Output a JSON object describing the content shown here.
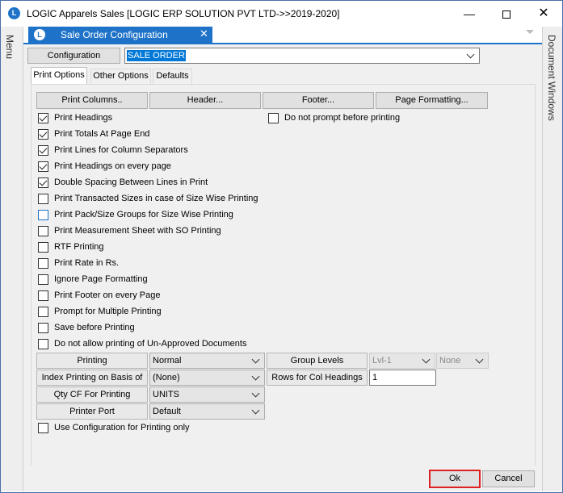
{
  "window": {
    "title": "LOGIC Apparels Sales  [LOGIC ERP SOLUTION PVT LTD->>2019-2020]",
    "app_icon_glyph": "L"
  },
  "side_panels": {
    "left": "Menu",
    "right": "Document Windows"
  },
  "doc_tab": {
    "label": "Sale Order Configuration",
    "close": "✕"
  },
  "configuration": {
    "button_label": "Configuration",
    "selected_value": "SALE ORDER"
  },
  "tabs": [
    "Print Options",
    "Other Options",
    "Defaults"
  ],
  "buttons": {
    "print_columns": "Print Columns..",
    "header": "Header...",
    "footer": "Footer...",
    "page_formatting": "Page Formatting..."
  },
  "checkboxes": [
    {
      "label": "Print Headings",
      "checked": true
    },
    {
      "label": "Print Totals At Page End",
      "checked": true
    },
    {
      "label": "Print Lines for Column Separators",
      "checked": true
    },
    {
      "label": "Print Headings on every page",
      "checked": true
    },
    {
      "label": "Double Spacing Between Lines in Print",
      "checked": true
    },
    {
      "label": "Print Transacted Sizes in case of Size Wise Printing",
      "checked": false
    },
    {
      "label": "Print Pack/Size Groups for Size Wise Printing",
      "checked": false
    },
    {
      "label": "Print Measurement Sheet with SO Printing",
      "checked": false
    },
    {
      "label": "RTF Printing",
      "checked": false
    },
    {
      "label": "Print Rate in Rs.",
      "checked": false
    },
    {
      "label": "Ignore Page Formatting",
      "checked": false
    },
    {
      "label": "Print Footer on every Page",
      "checked": false
    },
    {
      "label": "Prompt for Multiple Printing",
      "checked": false
    },
    {
      "label": "Save before Printing",
      "checked": false
    },
    {
      "label": "Do not allow printing of Un-Approved Documents",
      "checked": false
    }
  ],
  "do_not_prompt": {
    "label": "Do not prompt before printing",
    "checked": false
  },
  "fields": {
    "printing": {
      "label": "Printing",
      "value": "Normal"
    },
    "index_printing": {
      "label": "Index Printing on Basis of",
      "value": "(None)"
    },
    "qty_cf": {
      "label": "Qty CF For Printing",
      "value": "UNITS"
    },
    "printer_port": {
      "label": "Printer Port",
      "value": "Default"
    },
    "group_levels": {
      "label": "Group Levels",
      "value1": "Lvl-1",
      "value2": "None"
    },
    "rows_col_headings": {
      "label": "Rows for Col Headings",
      "value": "1"
    }
  },
  "use_config_only": {
    "label": "Use Configuration for Printing only",
    "checked": false
  },
  "footer_buttons": {
    "ok": "Ok",
    "cancel": "Cancel"
  }
}
